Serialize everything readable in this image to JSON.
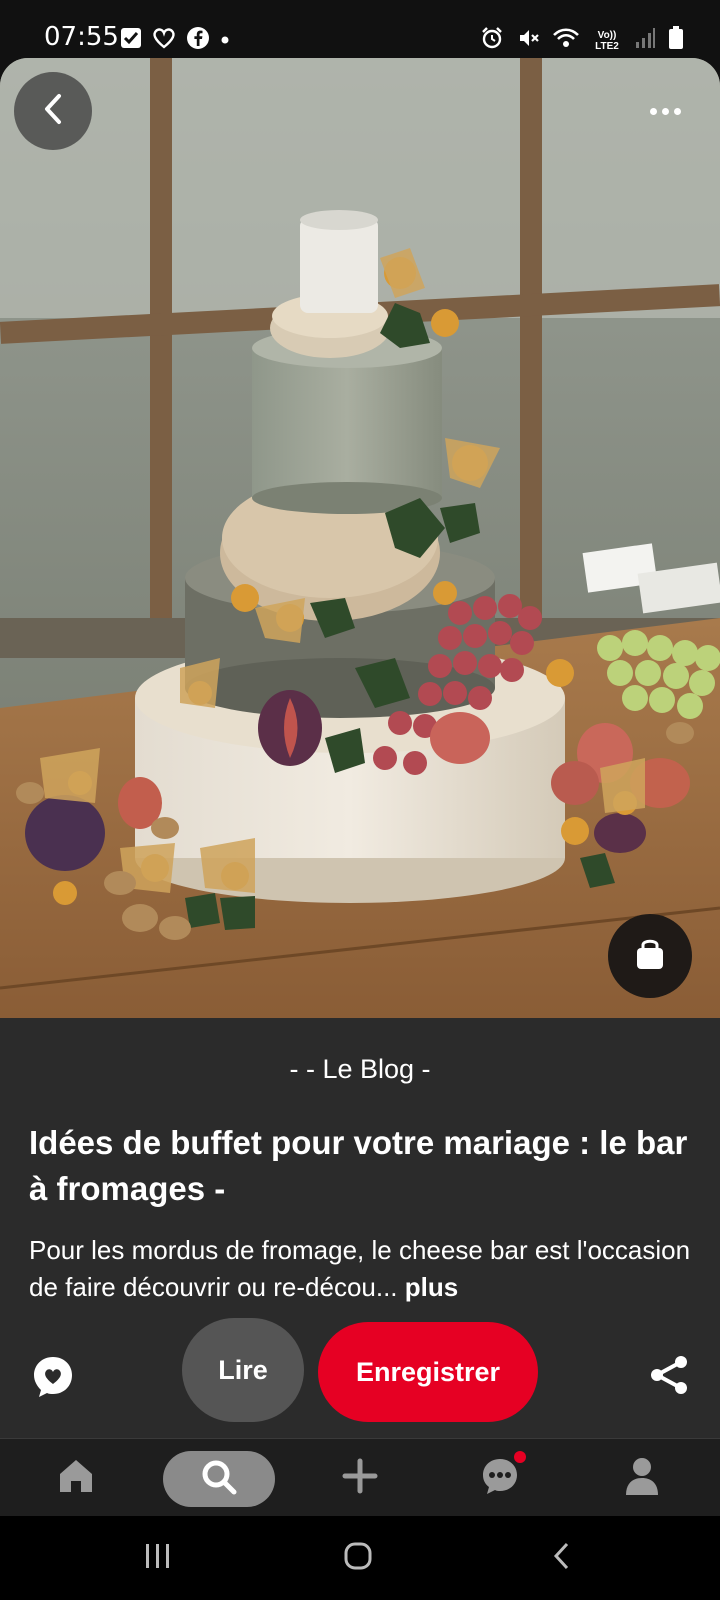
{
  "status_bar": {
    "time": "07:55",
    "left_icons": [
      "check-square-icon",
      "heart-outline-icon",
      "facebook-icon",
      "dot-icon"
    ],
    "right_icons": [
      "alarm-icon",
      "mute-icon",
      "wifi-icon",
      "volte-icon",
      "signal-icon",
      "battery-icon"
    ],
    "volte_text": "Vo)) LTE2"
  },
  "pin": {
    "image_description_icon": "cheese-tower-photo",
    "source": "- - Le Blog -",
    "title": "Idées de buffet pour votre mariage : le bar à fromages -",
    "description": "Pour les mordus de fromage, le cheese bar est l'occasion de faire découvrir ou re-décou...",
    "more_link": "plus"
  },
  "actions": {
    "read_label": "Lire",
    "save_label": "Enregistrer"
  },
  "nav": {
    "items": [
      "home-icon",
      "search-icon",
      "plus-icon",
      "messages-icon",
      "profile-icon"
    ],
    "active": "search-icon"
  },
  "colors": {
    "accent": "#e60023",
    "panel": "#2b2b2b",
    "nav_bg": "#1e1e1e"
  }
}
